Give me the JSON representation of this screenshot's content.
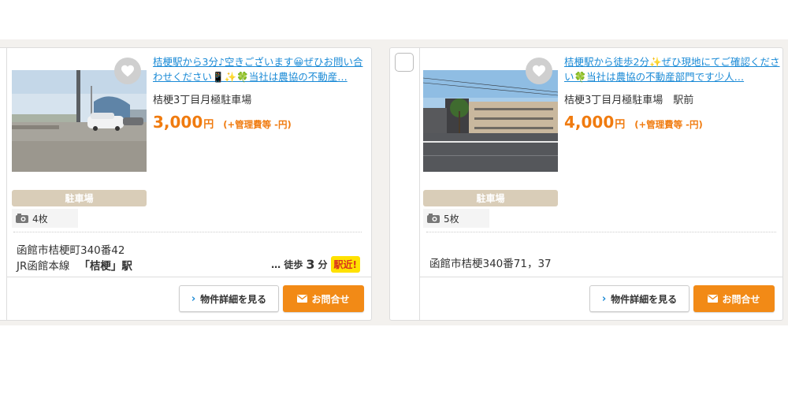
{
  "listings": [
    {
      "title": "桔梗駅から3分♪空きございます😀ぜひお問い合わせください📱✨🍀当社は農協の不動産…",
      "lot_name": "桔梗3丁目月極駐車場",
      "price": "3,000",
      "yen": "円",
      "management_fee": "(+管理費等 -円)",
      "category": "駐車場",
      "photo_count": "4枚",
      "address": "函館市桔梗町340番42",
      "line": "JR函館本線",
      "station": "「桔梗」駅",
      "walk_prefix": "… 徒歩",
      "walk_minutes": "3",
      "walk_unit": "分",
      "near_badge": "駅近!",
      "detail_button": "物件詳細を見る",
      "contact_button": "お問合せ"
    },
    {
      "title": "桔梗駅から徒歩2分✨ぜひ現地にてご確認ください🍀当社は農協の不動産部門です少人…",
      "lot_name": "桔梗3丁目月極駐車場　駅前",
      "price": "4,000",
      "yen": "円",
      "management_fee": "(+管理費等 -円)",
      "category": "駐車場",
      "photo_count": "5枚",
      "address": "函館市桔梗340番71，37",
      "detail_button": "物件詳細を見る",
      "contact_button": "お問合せ"
    }
  ],
  "icons": {
    "favorite": "heart-icon",
    "photos": "camera-icon",
    "detail": "chevron-right-icon",
    "contact": "envelope-icon"
  },
  "colors": {
    "link": "#1a8ad6",
    "price": "#f07b0f",
    "contact_button": "#f28a16",
    "category_badge": "#d9cdb8",
    "near_badge": "#ffe100"
  }
}
